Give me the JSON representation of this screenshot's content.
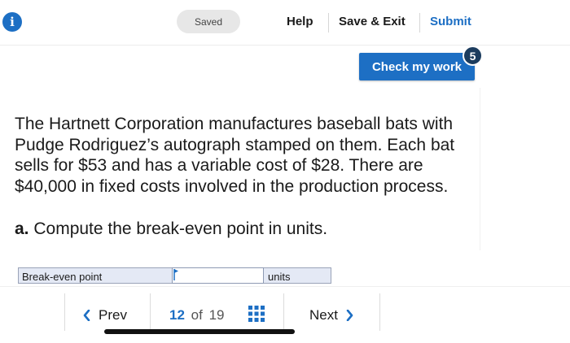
{
  "header": {
    "saved_label": "Saved",
    "help_label": "Help",
    "save_exit_label": "Save & Exit",
    "submit_label": "Submit",
    "info_icon": "info-icon",
    "info_glyph": "i"
  },
  "check_work": {
    "label": "Check my work",
    "badge_count": "5"
  },
  "question": {
    "text": "The Hartnett Corporation manufactures baseball bats with Pudge Rodriguez’s autograph stamped on them. Each bat sells for $53 and has a variable cost of $28. There are $40,000 in fixed costs involved in the production process.",
    "part_label": "a.",
    "part_text": "Compute the break-even point in units."
  },
  "answer": {
    "label": "Break-even point",
    "value": "",
    "unit": "units"
  },
  "pager": {
    "prev_label": "Prev",
    "current_page": "12",
    "of_label": "of",
    "total_pages": "19",
    "next_label": "Next",
    "prev_icon": "chevron-left-icon",
    "next_icon": "chevron-right-icon",
    "grid_icon": "grid-icon"
  },
  "colors": {
    "accent": "#1d6fc4",
    "badge": "#1c3c5e",
    "answer_row": "#e4e9f5"
  }
}
